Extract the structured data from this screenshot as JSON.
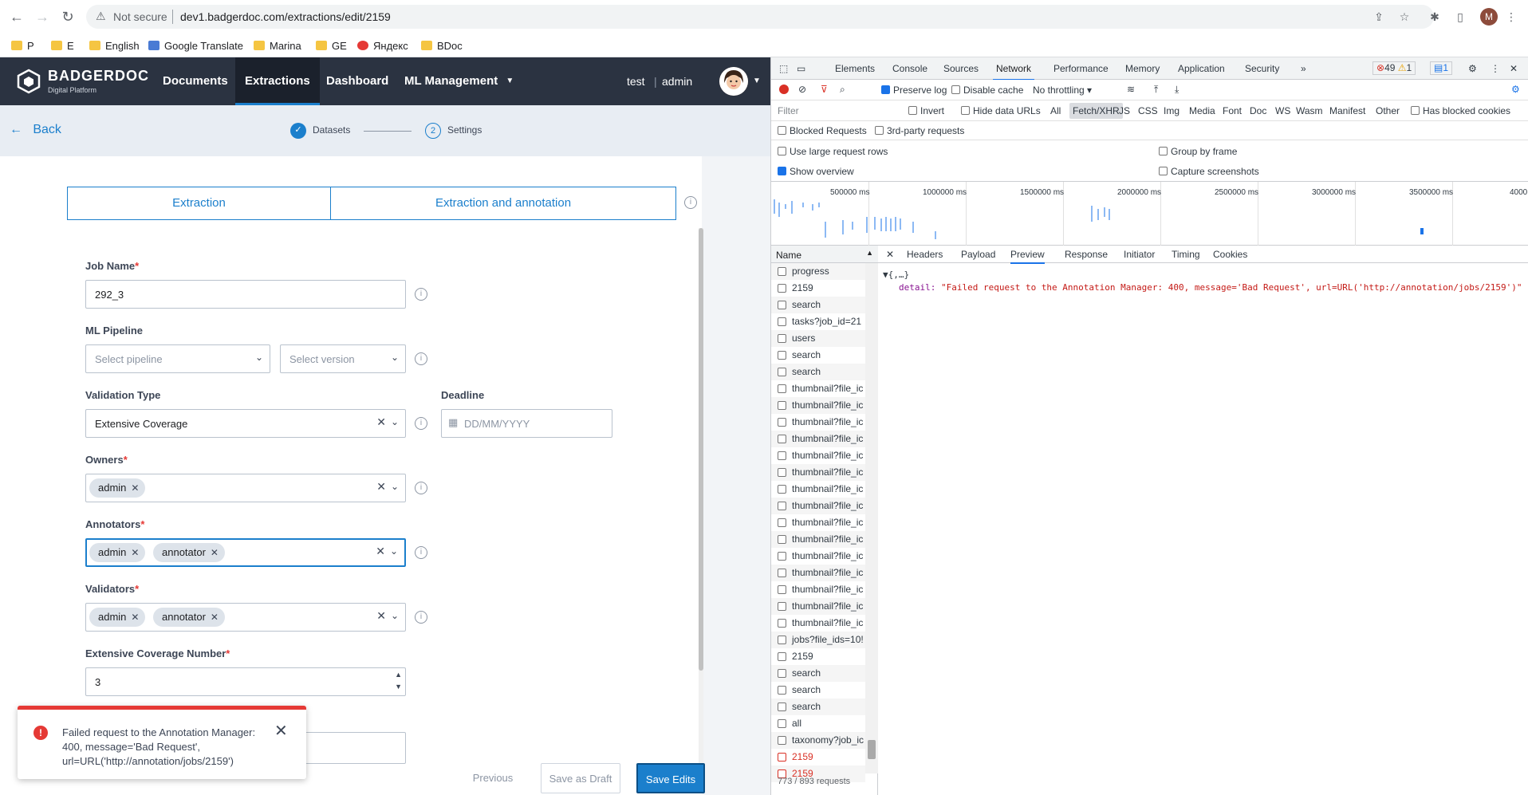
{
  "browser": {
    "security": "Not secure",
    "url": "dev1.badgerdoc.com/extractions/edit/2159",
    "profile_initial": "M",
    "bookmarks": [
      "P",
      "E",
      "English",
      "Google Translate",
      "Marina",
      "GE",
      "Яндекс",
      "BDoc"
    ]
  },
  "header": {
    "logo_title": "BADGERDOC",
    "logo_subtitle": "Digital Platform",
    "nav": [
      "Documents",
      "Extractions",
      "Dashboard",
      "ML Management"
    ],
    "user_name": "test",
    "user_role": "admin"
  },
  "wizard": {
    "back_label": "Back",
    "step1_label": "Datasets",
    "step2_num": "2",
    "step2_label": "Settings"
  },
  "form": {
    "tab_extraction": "Extraction",
    "tab_extraction_annotation": "Extraction and annotation",
    "job_name_label": "Job Name",
    "job_name_value": "292_3",
    "ml_pipeline_label": "ML Pipeline",
    "pipeline_placeholder": "Select pipeline",
    "version_placeholder": "Select version",
    "validation_type_label": "Validation Type",
    "validation_type_value": "Extensive Coverage",
    "deadline_label": "Deadline",
    "deadline_placeholder": "DD/MM/YYYY",
    "owners_label": "Owners",
    "owners": [
      "admin"
    ],
    "annotators_label": "Annotators",
    "annotators": [
      "admin",
      "annotator"
    ],
    "validators_label": "Validators",
    "validators": [
      "admin",
      "annotator"
    ],
    "coverage_label": "Extensive Coverage Number",
    "coverage_value": "3",
    "required_mark": "*"
  },
  "footer": {
    "previous": "Previous",
    "save_draft": "Save as Draft",
    "save_edits": "Save Edits"
  },
  "toast": {
    "message": "Failed request to the Annotation Manager: 400, message='Bad Request', url=URL('http://annotation/jobs/2159')"
  },
  "devtools": {
    "tabs": [
      "Elements",
      "Console",
      "Sources",
      "Network",
      "Performance",
      "Memory",
      "Application",
      "Security"
    ],
    "more": "»",
    "error_count": "49",
    "warn_count": "1",
    "msg_count": "1",
    "preserve_log": "Preserve log",
    "disable_cache": "Disable cache",
    "throttling": "No throttling",
    "filter_placeholder": "Filter",
    "invert": "Invert",
    "hide_data_urls": "Hide data URLs",
    "type_filters": [
      "All",
      "Fetch/XHR",
      "JS",
      "CSS",
      "Img",
      "Media",
      "Font",
      "Doc",
      "WS",
      "Wasm",
      "Manifest",
      "Other"
    ],
    "has_blocked_cookies": "Has blocked cookies",
    "blocked_requests": "Blocked Requests",
    "third_party": "3rd-party requests",
    "large_rows": "Use large request rows",
    "group_by_frame": "Group by frame",
    "show_overview": "Show overview",
    "capture_screenshots": "Capture screenshots",
    "timeline_ticks": [
      "500000 ms",
      "1000000 ms",
      "1500000 ms",
      "2000000 ms",
      "2500000 ms",
      "3000000 ms",
      "3500000 ms",
      "4000"
    ],
    "name_header": "Name",
    "detail_tabs": [
      "Headers",
      "Payload",
      "Preview",
      "Response",
      "Initiator",
      "Timing",
      "Cookies"
    ],
    "requests": [
      {
        "name": "progress",
        "error": false
      },
      {
        "name": "2159",
        "error": false
      },
      {
        "name": "search",
        "error": false
      },
      {
        "name": "tasks?job_id=21",
        "error": false
      },
      {
        "name": "users",
        "error": false
      },
      {
        "name": "search",
        "error": false
      },
      {
        "name": "search",
        "error": false
      },
      {
        "name": "thumbnail?file_ic",
        "error": false
      },
      {
        "name": "thumbnail?file_ic",
        "error": false
      },
      {
        "name": "thumbnail?file_ic",
        "error": false
      },
      {
        "name": "thumbnail?file_ic",
        "error": false
      },
      {
        "name": "thumbnail?file_ic",
        "error": false
      },
      {
        "name": "thumbnail?file_ic",
        "error": false
      },
      {
        "name": "thumbnail?file_ic",
        "error": false
      },
      {
        "name": "thumbnail?file_ic",
        "error": false
      },
      {
        "name": "thumbnail?file_ic",
        "error": false
      },
      {
        "name": "thumbnail?file_ic",
        "error": false
      },
      {
        "name": "thumbnail?file_ic",
        "error": false
      },
      {
        "name": "thumbnail?file_ic",
        "error": false
      },
      {
        "name": "thumbnail?file_ic",
        "error": false
      },
      {
        "name": "thumbnail?file_ic",
        "error": false
      },
      {
        "name": "thumbnail?file_ic",
        "error": false
      },
      {
        "name": "jobs?file_ids=10!",
        "error": false
      },
      {
        "name": "2159",
        "error": false
      },
      {
        "name": "search",
        "error": false
      },
      {
        "name": "search",
        "error": false
      },
      {
        "name": "search",
        "error": false
      },
      {
        "name": "all",
        "error": false
      },
      {
        "name": "taxonomy?job_ic",
        "error": false
      },
      {
        "name": "2159",
        "error": true
      },
      {
        "name": "2159",
        "error": true
      }
    ],
    "request_count": "773 / 893 requests",
    "preview_root": "{,…}",
    "preview_key": "detail:",
    "preview_value": "\"Failed request to the Annotation Manager: 400, message='Bad Request', url=URL('http://annotation/jobs/2159')\""
  },
  "colors": {
    "header_bg": "#2b3341",
    "accent": "#1b7fcc",
    "error": "#e53935"
  }
}
